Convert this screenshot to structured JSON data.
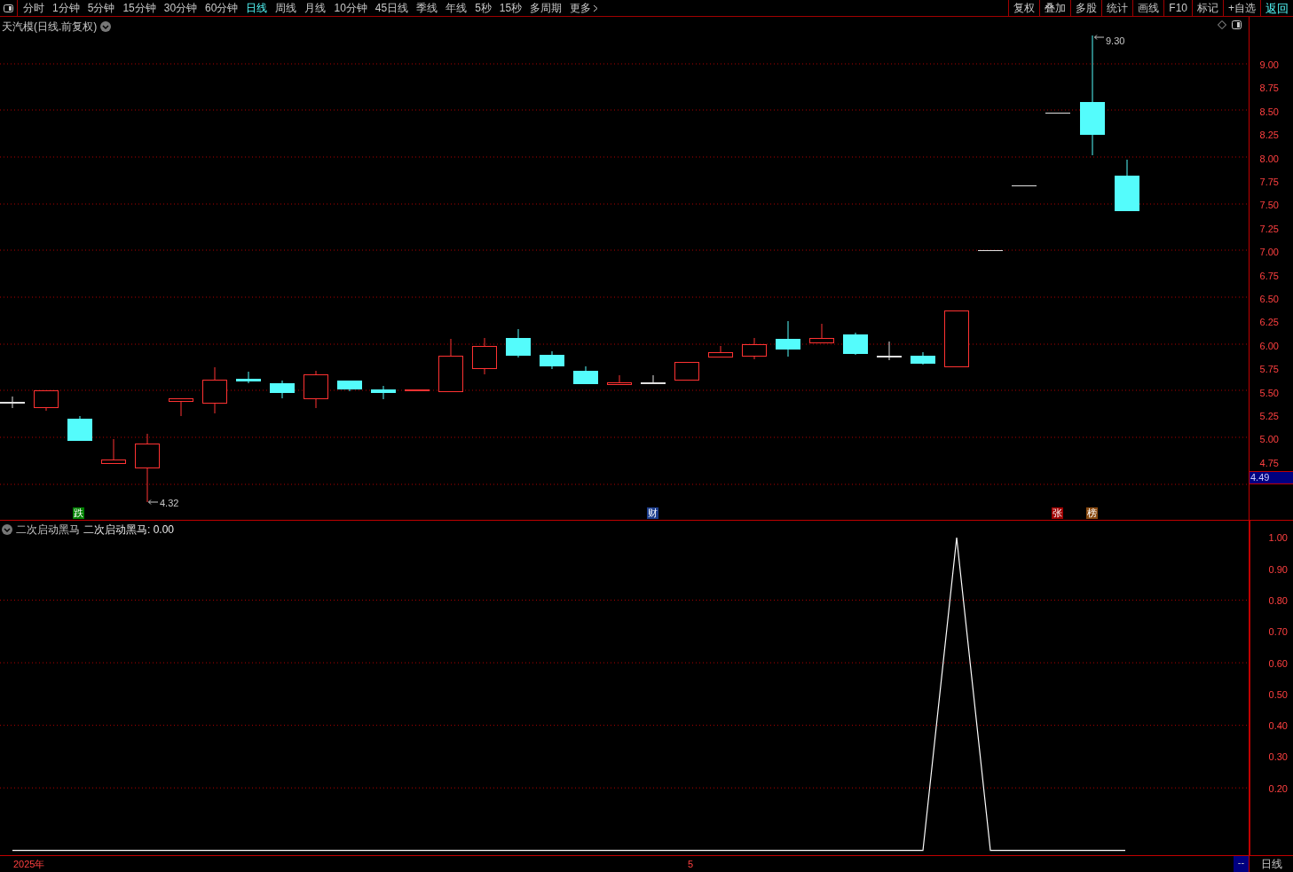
{
  "toolbar": {
    "periods": [
      {
        "label": "分时",
        "selected": false
      },
      {
        "label": "1分钟",
        "selected": false
      },
      {
        "label": "5分钟",
        "selected": false
      },
      {
        "label": "15分钟",
        "selected": false
      },
      {
        "label": "30分钟",
        "selected": false
      },
      {
        "label": "60分钟",
        "selected": false
      },
      {
        "label": "日线",
        "selected": true
      },
      {
        "label": "周线",
        "selected": false
      },
      {
        "label": "月线",
        "selected": false
      },
      {
        "label": "10分钟",
        "selected": false
      },
      {
        "label": "45日线",
        "selected": false
      },
      {
        "label": "季线",
        "selected": false
      },
      {
        "label": "年线",
        "selected": false
      },
      {
        "label": "5秒",
        "selected": false
      },
      {
        "label": "15秒",
        "selected": false
      },
      {
        "label": "多周期",
        "selected": false
      }
    ],
    "more": "更多",
    "actions": [
      {
        "label": "复权",
        "kind": "plain"
      },
      {
        "label": "叠加",
        "kind": "plain"
      },
      {
        "label": "多股",
        "kind": "plain"
      },
      {
        "label": "统计",
        "kind": "plain"
      },
      {
        "label": "画线",
        "kind": "plain"
      },
      {
        "label": "F10",
        "kind": "plain"
      },
      {
        "label": "标记",
        "kind": "plain"
      },
      {
        "label": "+自选",
        "kind": "plain"
      },
      {
        "label": "返回",
        "kind": "accent"
      }
    ]
  },
  "main_chart": {
    "title": "天汽模(日线.前复权)",
    "axis_labels": [
      "9.00",
      "8.75",
      "8.50",
      "8.25",
      "8.00",
      "7.75",
      "7.50",
      "7.25",
      "7.00",
      "6.75",
      "6.50",
      "6.25",
      "6.00",
      "5.75",
      "5.50",
      "5.25",
      "5.00",
      "4.75"
    ],
    "current_price": "4.49",
    "high_label": "9.30",
    "low_label": "4.32",
    "markers": [
      {
        "text": "跌",
        "color": "#008000"
      },
      {
        "text": "财",
        "color": "#1c3d8c"
      },
      {
        "text": "张",
        "color": "#a00000"
      },
      {
        "text": "榜",
        "color": "#8a4a10"
      }
    ]
  },
  "indicator": {
    "reading": "二次启动黑马: 0.00",
    "chart_data": {
      "type": "line",
      "ylim": [
        -0.015,
        1.054
      ],
      "grid": true,
      "yticks": [
        {
          "value": 0.2,
          "label": "0.20"
        },
        {
          "value": 0.3,
          "label": "0.30"
        },
        {
          "value": 0.4,
          "label": "0.40"
        },
        {
          "value": 0.5,
          "label": "0.50"
        },
        {
          "value": 0.6,
          "label": "0.60"
        },
        {
          "value": 0.7,
          "label": "0.70"
        },
        {
          "value": 0.8,
          "label": "0.80"
        },
        {
          "value": 0.9,
          "label": "0.90"
        },
        {
          "value": 1,
          "label": "1.00"
        }
      ],
      "series": [
        {
          "name": "二次启动黑马",
          "color": "#ffffff",
          "values": [
            0,
            0,
            0,
            0,
            0,
            0,
            0,
            0,
            0,
            0,
            0,
            0,
            0,
            0,
            0,
            0,
            0,
            0,
            0,
            0,
            0,
            0,
            0,
            0,
            0,
            0,
            0,
            0,
            1,
            0,
            0,
            0,
            0,
            0
          ]
        }
      ]
    }
  },
  "bottom_bar": {
    "year": "2025年",
    "month": "5",
    "indicator": "--",
    "period": "日线"
  }
}
